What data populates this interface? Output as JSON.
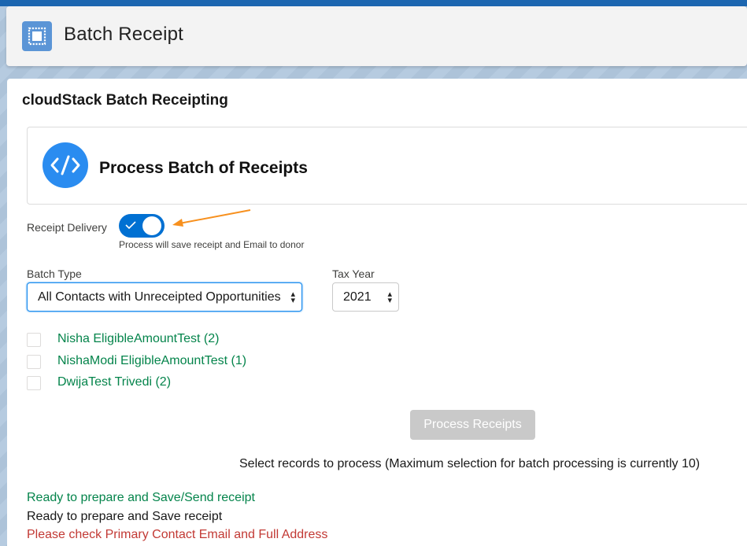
{
  "header": {
    "title": "Batch Receipt",
    "icon": "batch-receipt-icon"
  },
  "main": {
    "title": "cloudStack Batch Receipting",
    "card_title": "Process Batch of Receipts",
    "card_icon": "code-icon"
  },
  "receipt_delivery": {
    "label": "Receipt Delivery",
    "enabled": true,
    "helper": "Process will save receipt and Email to donor"
  },
  "batch_type": {
    "label": "Batch Type",
    "value": "All Contacts with Unreceipted Opportunities"
  },
  "tax_year": {
    "label": "Tax Year",
    "value": "2021"
  },
  "contacts": [
    {
      "label": "Nisha EligibleAmountTest (2)",
      "checked": false
    },
    {
      "label": "NishaModi EligibleAmountTest (1)",
      "checked": false
    },
    {
      "label": "DwijaTest Trivedi (2)",
      "checked": false
    }
  ],
  "process_button": {
    "label": "Process Receipts",
    "disabled": true
  },
  "selection_note": "Select records to process (Maximum selection for batch processing is currently 10)",
  "legend": [
    {
      "text": "Ready to prepare and Save/Send receipt",
      "color": "#04844b"
    },
    {
      "text": "Ready to prepare and Save receipt",
      "color": "#181818"
    },
    {
      "text": "Please check Primary Contact Email and Full Address",
      "color": "#c23934"
    }
  ],
  "colors": {
    "brand": "#0070d2",
    "success": "#04844b",
    "error": "#c23934",
    "annotation_arrow": "#f7901e"
  }
}
